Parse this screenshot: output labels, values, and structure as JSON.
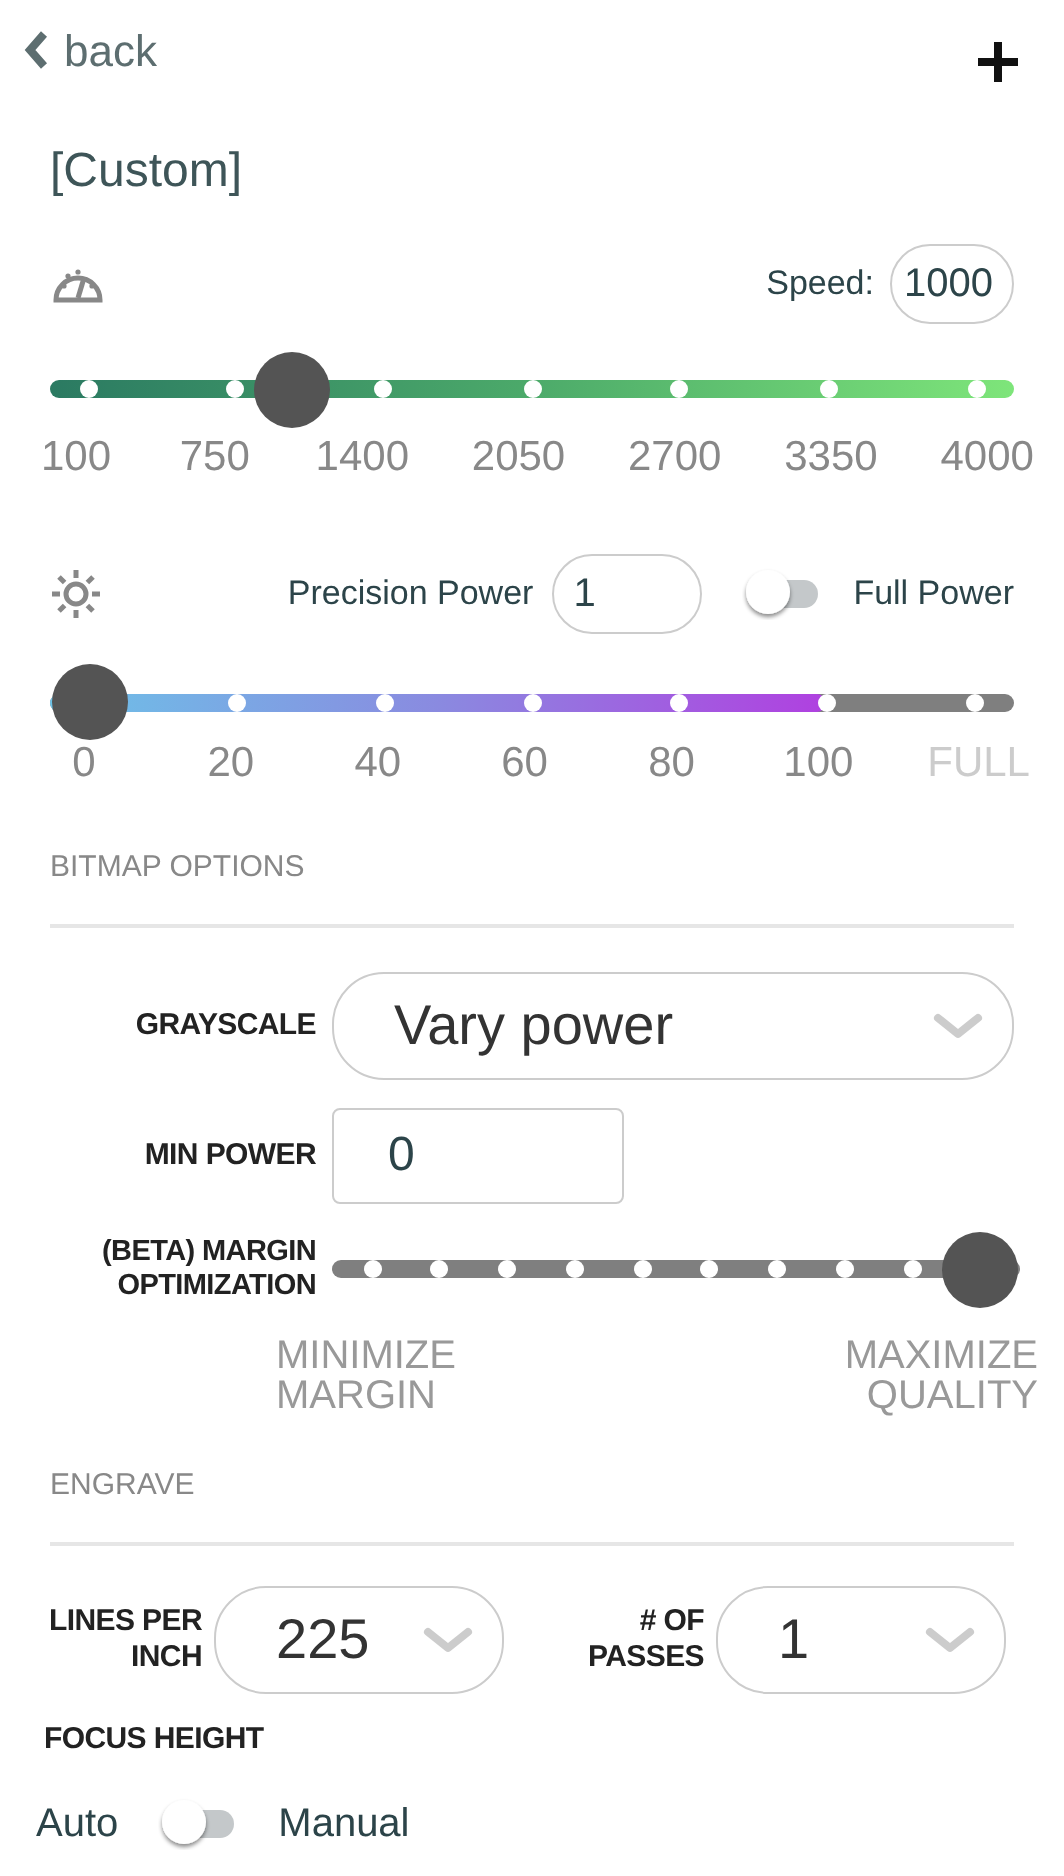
{
  "back": {
    "label": "back"
  },
  "preset_title": "[Custom]",
  "speed": {
    "label": "Speed:",
    "value": "1000",
    "level": 0.23,
    "ticks": [
      {
        "label": "100",
        "disabled": false
      },
      {
        "label": "750",
        "disabled": false
      },
      {
        "label": "1400",
        "disabled": false
      },
      {
        "label": "2050",
        "disabled": false
      },
      {
        "label": "2700",
        "disabled": false
      },
      {
        "label": "3350",
        "disabled": false
      },
      {
        "label": "4000",
        "disabled": false
      }
    ]
  },
  "power": {
    "label": "Precision Power",
    "value": "1",
    "full_power": {
      "label": "Full Power",
      "on": false
    },
    "level": 0,
    "ticks": [
      {
        "label": "0",
        "disabled": false
      },
      {
        "label": "20",
        "disabled": false
      },
      {
        "label": "40",
        "disabled": false
      },
      {
        "label": "60",
        "disabled": false
      },
      {
        "label": "80",
        "disabled": false
      },
      {
        "label": "100",
        "disabled": false
      },
      {
        "label": "FULL",
        "disabled": true
      }
    ]
  },
  "bitmap_options": {
    "heading": "BITMAP OPTIONS",
    "grayscale": {
      "label": "GRAYSCALE",
      "value": "Vary power"
    },
    "min_power": {
      "label": "MIN POWER",
      "value": "0"
    },
    "margin_optimization": {
      "label": "(BETA) MARGIN OPTIMIZATION",
      "level": 1,
      "min_label": "MINIMIZE MARGIN",
      "max_label": "MAXIMIZE QUALITY"
    }
  },
  "engrave": {
    "heading": "ENGRAVE",
    "lines_per_inch": {
      "label": "LINES PER INCH",
      "value": "225"
    },
    "passes": {
      "label": "# OF PASSES",
      "value": "1"
    },
    "focus_height": {
      "label": "FOCUS HEIGHT",
      "left_label": "Auto",
      "right_label": "Manual",
      "on": false
    }
  }
}
